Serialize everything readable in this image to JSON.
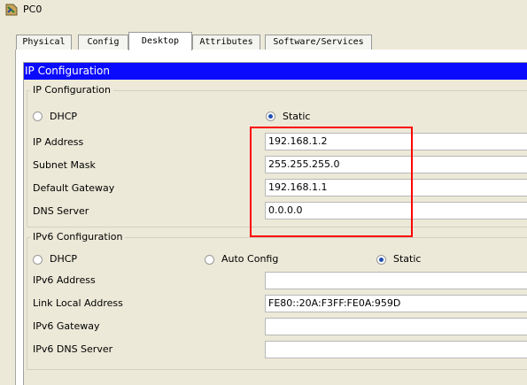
{
  "window": {
    "title": "PC0"
  },
  "tabs": [
    {
      "label": "Physical"
    },
    {
      "label": "Config"
    },
    {
      "label": "Desktop"
    },
    {
      "label": "Attributes"
    },
    {
      "label": "Software/Services"
    }
  ],
  "active_tab": "Desktop",
  "header": {
    "title": "IP Configuration"
  },
  "ipv4": {
    "group_title": "IP Configuration",
    "dhcp_label": "DHCP",
    "static_label": "Static",
    "selected_mode": "Static",
    "fields": [
      {
        "label": "IP Address",
        "value": "192.168.1.2"
      },
      {
        "label": "Subnet Mask",
        "value": "255.255.255.0"
      },
      {
        "label": "Default Gateway",
        "value": "192.168.1.1"
      },
      {
        "label": "DNS Server",
        "value": "0.0.0.0"
      }
    ]
  },
  "ipv6": {
    "group_title": "IPv6 Configuration",
    "dhcp_label": "DHCP",
    "auto_label": "Auto Config",
    "static_label": "Static",
    "selected_mode": "Static",
    "fields": [
      {
        "label": "IPv6 Address",
        "value": ""
      },
      {
        "label": "Link Local Address",
        "value": "FE80::20A:F3FF:FE0A:959D"
      },
      {
        "label": "IPv6 Gateway",
        "value": ""
      },
      {
        "label": "IPv6 DNS Server",
        "value": ""
      }
    ]
  },
  "colors": {
    "header_bg": "#0a0aff",
    "highlight": "#ff0000",
    "window_bg": "#ece9d8"
  }
}
